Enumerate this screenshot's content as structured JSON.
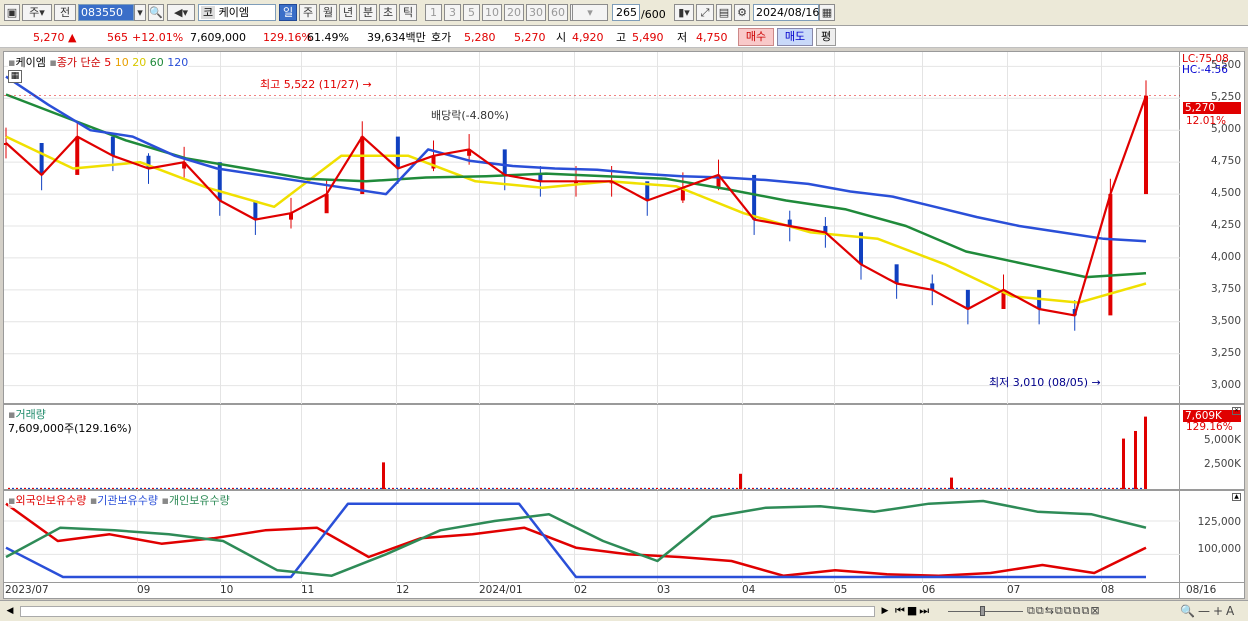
{
  "toolbar": {
    "market_btn": "주",
    "prev_btn": "전",
    "code": "083550",
    "name_prefix": "코",
    "name": "케이엠",
    "period_buttons": [
      "일",
      "주",
      "월",
      "년",
      "분",
      "초",
      "틱"
    ],
    "minute_buttons": [
      "1",
      "3",
      "5",
      "10",
      "20",
      "30",
      "60",
      "120"
    ],
    "count": "265",
    "count_total": "/600",
    "date": "2024/08/16"
  },
  "quote": {
    "price": "5,270",
    "up_mark": "▲",
    "change": "565",
    "change_pct": "+12.01%",
    "volume": "7,609,000",
    "vol_ratio": "129.16%",
    "turnover": "61.49%",
    "amount": "39,634백만",
    "hoga_label": "호가",
    "hoga1": "5,280",
    "hoga2": "5,270",
    "open_label": "시",
    "open": "4,920",
    "high_label": "고",
    "high": "5,490",
    "low_label": "저",
    "low": "4,750",
    "buy": "매수",
    "sell": "매도",
    "eval": "평"
  },
  "price_panel": {
    "stock_label": "케이엠",
    "ma_label": "종가 단순",
    "ma_periods": [
      "5",
      "10",
      "20",
      "60",
      "120"
    ],
    "lc": "LC:75.08",
    "hc": "HC:-4.56",
    "current_price": "5,270",
    "current_pct": "12.01%",
    "high_annot": "최고 5,522 (11/27)",
    "low_annot": "최저 3,010 (08/05)",
    "dividend_annot": "배당락(-4.80%)"
  },
  "volume_panel": {
    "label": "거래량",
    "value": "7,609,000주(129.16%)",
    "current": "7,609K",
    "current_pct": "129.16%",
    "axis": [
      "5,000K",
      "2,500K"
    ]
  },
  "holding_panel": {
    "foreign": "외국인보유수량",
    "institution": "기관보유수량",
    "individual": "개인보유수량",
    "axis": [
      "125,000",
      "100,000"
    ]
  },
  "x_axis": {
    "labels": [
      "2023/07",
      "09",
      "10",
      "11",
      "12",
      "2024/01",
      "02",
      "03",
      "04",
      "05",
      "06",
      "07",
      "08"
    ],
    "end": "08/16"
  },
  "chart_data": {
    "type": "line",
    "title": "케이엠",
    "price_axis": [
      "5,500",
      "5,250",
      "5,000",
      "4,750",
      "4,500",
      "4,250",
      "4,000",
      "3,750",
      "3,500",
      "3,250",
      "3,000"
    ],
    "ylim": [
      2950,
      5550
    ],
    "x": [
      "2023/07",
      "09",
      "10",
      "11",
      "12",
      "2024/01",
      "02",
      "03",
      "04",
      "05",
      "06",
      "07",
      "08",
      "08/16"
    ],
    "series": [
      {
        "name": "종가",
        "color": "#e00000",
        "values": [
          4900,
          4650,
          4950,
          4800,
          4700,
          4750,
          4450,
          4300,
          4350,
          4500,
          4950,
          4700,
          4800,
          4850,
          4650,
          4600,
          4600,
          4600,
          4450,
          4550,
          4650,
          4300,
          4250,
          4200,
          3950,
          3800,
          3750,
          3600,
          3750,
          3600,
          3550,
          4500,
          5270
        ]
      },
      {
        "name": "120",
        "color": "#2a4fd8",
        "values": [
          5420,
          5200,
          5000,
          4950,
          4800,
          4700,
          4650,
          4600,
          4550,
          4500,
          4850,
          4760,
          4720,
          4700,
          4690,
          4660,
          4640,
          4630,
          4610,
          4580,
          4520,
          4480,
          4400,
          4320,
          4250,
          4200,
          4150,
          4130
        ]
      },
      {
        "name": "60",
        "color": "#1f8a3a",
        "values": [
          5280,
          5100,
          4920,
          4780,
          4700,
          4620,
          4600,
          4630,
          4640,
          4660,
          4640,
          4620,
          4540,
          4450,
          4380,
          4250,
          4050,
          3950,
          3850,
          3880
        ]
      },
      {
        "name": "20",
        "color": "#f0e000",
        "values": [
          4950,
          4700,
          4750,
          4550,
          4400,
          4800,
          4800,
          4600,
          4550,
          4600,
          4560,
          4350,
          4200,
          4150,
          3950,
          3700,
          3650,
          3800
        ]
      }
    ],
    "volume_spikes_k": [
      {
        "x": "11",
        "v": 2800
      },
      {
        "x": "04",
        "v": 1600
      },
      {
        "x": "06",
        "v": 1200
      },
      {
        "x": "08",
        "v": 5300
      },
      {
        "x": "08",
        "v": 6100
      },
      {
        "x": "08/16",
        "v": 7609
      }
    ],
    "volume_ylim": [
      0,
      8200
    ],
    "holdings": [
      {
        "name": "외국인보유수량",
        "color": "#e00000",
        "values": [
          138000,
          110000,
          115000,
          108000,
          112000,
          118000,
          120000,
          98000,
          112000,
          115000,
          120000,
          105000,
          100000,
          98000,
          95000,
          84000,
          88000,
          85000,
          84000,
          86000,
          92000,
          86000,
          105000
        ]
      },
      {
        "name": "기관보유수량",
        "color": "#2a4fd8",
        "values": [
          105000,
          83000,
          83000,
          83000,
          83000,
          83000,
          138000,
          138000,
          138000,
          138000,
          83000,
          83000,
          83000,
          83000,
          83000,
          83000,
          83000,
          83000,
          83000,
          83000,
          83000
        ]
      },
      {
        "name": "개인보유수량",
        "color": "#2e8b57",
        "values": [
          98000,
          120000,
          118000,
          115000,
          110000,
          88000,
          84000,
          100000,
          118000,
          125000,
          130000,
          110000,
          95000,
          128000,
          135000,
          136000,
          132000,
          138000,
          140000,
          132000,
          130000,
          120000
        ]
      }
    ],
    "holdings_ylim": [
      80000,
      143000
    ],
    "grid": true
  }
}
